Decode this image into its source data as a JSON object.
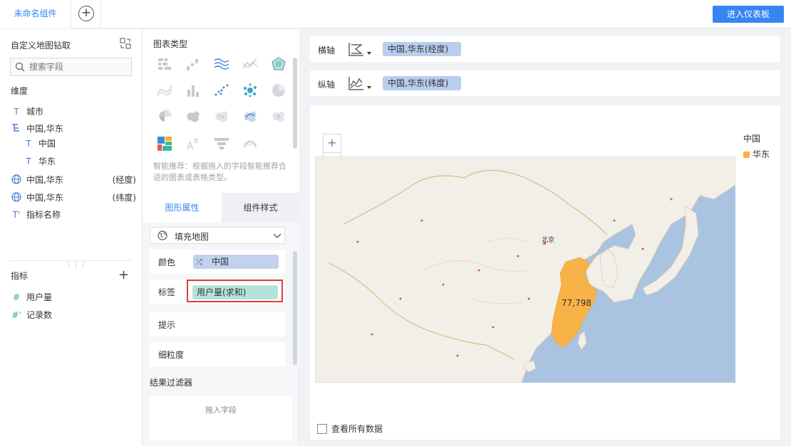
{
  "topbar": {
    "tab_label": "未命名组件",
    "add_tab_symbol": "+",
    "enter_dashboard": "进入仪表板"
  },
  "left": {
    "title": "自定义地图钻取",
    "search_placeholder": "搜索字段",
    "dimension_label": "维度",
    "dimensions": [
      {
        "icon": "T",
        "label": "城市",
        "suffix": ""
      },
      {
        "icon": "T",
        "label": "中国,华东",
        "suffix": ""
      },
      {
        "icon": "T",
        "label": "中国",
        "suffix": ""
      },
      {
        "icon": "T",
        "label": "华东",
        "suffix": ""
      },
      {
        "icon": "globe",
        "label": "中国,华东",
        "suffix": "(经度)"
      },
      {
        "icon": "globe",
        "label": "中国,华东",
        "suffix": "(纬度)"
      },
      {
        "icon": "T'",
        "label": "指标名称",
        "suffix": ""
      }
    ],
    "measure_label": "指标",
    "measures": [
      {
        "icon": "#",
        "label": "用户量"
      },
      {
        "icon": "#'",
        "label": "记录数"
      }
    ]
  },
  "middle": {
    "chart_type_title": "图表类型",
    "smart_tip": "智能推荐：根据拖入的字段智能推荐合适的图表或表格类型。",
    "tabs": [
      "图形属性",
      "组件样式"
    ],
    "map_type": "填充地图",
    "props": {
      "color_label": "颜色",
      "color_field": "中国",
      "label_label": "标签",
      "label_field": "用户量(求和)",
      "tooltip_label": "提示",
      "granularity_label": "细粒度"
    },
    "filter_title": "结果过滤器",
    "drop_hint": "拖入字段"
  },
  "axes": {
    "x_label": "横轴",
    "x_field": "中国,华东(经度)",
    "y_label": "纵轴",
    "y_field": "中国,华东(纬度)"
  },
  "chart": {
    "legend_title": "中国",
    "legend_item": "华东",
    "region_value": "77,798",
    "highlight_color": "#f7b347",
    "city_labels": {
      "beijing": "北京"
    },
    "see_all": "查看所有数据",
    "zoom_in": "+",
    "zoom_out": "−"
  }
}
